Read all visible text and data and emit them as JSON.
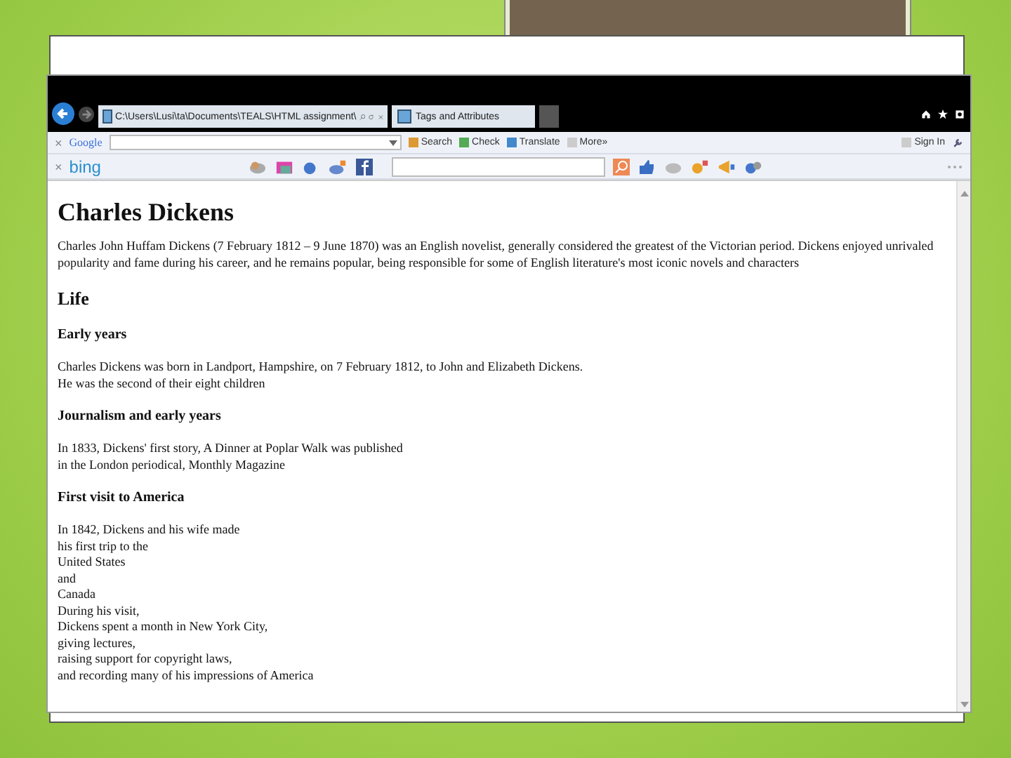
{
  "browser": {
    "address": "C:\\Users\\Lusi\\ta\\Documents\\TEALS\\HTML assignment\\",
    "tabs": [
      {
        "title": "Tags and Attributes",
        "selected": true
      }
    ]
  },
  "google_toolbar": {
    "close": "×",
    "logo": "Google",
    "buttons": [
      "Search",
      "Check",
      "Translate",
      "More»"
    ],
    "sign_in": "Sign In"
  },
  "bing_toolbar": {
    "close": "×",
    "logo": "bing"
  },
  "page": {
    "title": "Charles Dickens",
    "blocks": [
      {
        "kind": "p",
        "lines": [
          "Charles John Huffam Dickens (7 February 1812 – 9 June 1870) was an English novelist, generally considered the greatest of the Victorian period. Dickens enjoyed unrivaled popularity and fame during his career, and he remains popular, being responsible for some of English literature's most iconic novels and characters"
        ]
      },
      {
        "kind": "h2",
        "text": "Life"
      },
      {
        "kind": "h3",
        "text": "Early years"
      },
      {
        "kind": "p",
        "lines": [
          "Charles Dickens was born in Landport, Hampshire, on 7 February 1812, to John and Elizabeth Dickens.",
          "He was the second of their eight children"
        ]
      },
      {
        "kind": "h3",
        "text": "Journalism and early years"
      },
      {
        "kind": "p",
        "lines": [
          "In 1833, Dickens' first story, A Dinner at Poplar Walk was published",
          "in the London periodical, Monthly Magazine"
        ]
      },
      {
        "kind": "h3",
        "text": "First visit to America"
      },
      {
        "kind": "p",
        "lines": [
          "In 1842, Dickens and his wife made",
          "his first trip to the",
          "United States",
          "and",
          "Canada",
          "During his visit,",
          "Dickens spent a month in New York City,",
          "giving lectures,",
          "raising support for copyright laws,",
          "and recording many of his impressions of America"
        ]
      }
    ]
  }
}
